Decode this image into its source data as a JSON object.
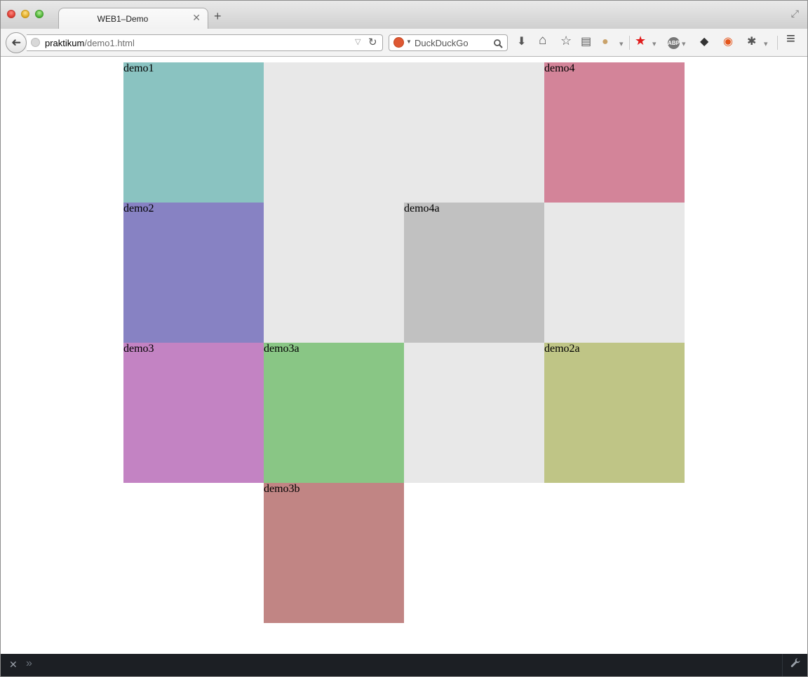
{
  "tab": {
    "title": "WEB1–Demo",
    "close": "✕",
    "new_tab": "+"
  },
  "window": {
    "fullscreen_icon": "⤢"
  },
  "navbar": {
    "back_icon": "➜",
    "url_host": "praktikum",
    "url_path": "/demo1.html",
    "url_dropdown_icon": "▽",
    "reload_icon": "↻",
    "search_engine": "DuckDuckGo",
    "search_dropdown_icon": "▼",
    "search_go_icon": "🔍",
    "tools": {
      "download_icon": "⬇",
      "home_icon": "⌂",
      "bookmark_star_icon": "☆",
      "reader_list_icon": "▤",
      "greasemonkey_icon": "●",
      "dropdown_icon": "▾",
      "red_star_icon": "★",
      "abp_icon": "ABP",
      "diamond_icon": "◆",
      "privacy_icon": "◉",
      "bug_icon": "✱",
      "menu_icon": "≡"
    }
  },
  "boxes": {
    "demo1": {
      "label": "demo1",
      "color": "#8ac3c1"
    },
    "demo4": {
      "label": "demo4",
      "color": "#d38499"
    },
    "demo2": {
      "label": "demo2",
      "color": "#8782c3"
    },
    "demo4a": {
      "label": "demo4a",
      "color": "#c1c1c1"
    },
    "demo3": {
      "label": "demo3",
      "color": "#c383c3"
    },
    "demo3a": {
      "label": "demo3a",
      "color": "#89c685"
    },
    "demo2a": {
      "label": "demo2a",
      "color": "#bfc586"
    },
    "demo3b": {
      "label": "demo3b",
      "color": "#c18584"
    }
  },
  "content": {
    "grid_background": "#e8e8e8"
  },
  "devbar": {
    "close_icon": "✕",
    "chevron_icon": "»",
    "wrench_icon": "🔧"
  }
}
